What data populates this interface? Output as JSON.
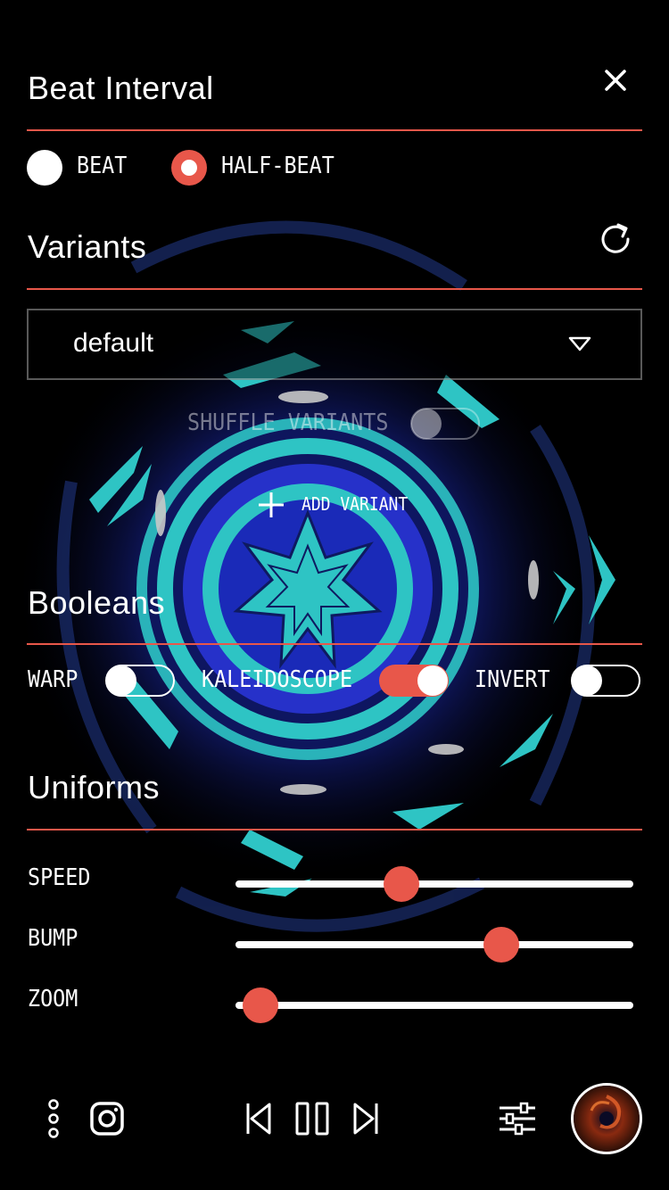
{
  "beat_interval": {
    "title": "Beat Interval",
    "options": [
      {
        "label": "BEAT",
        "selected": false
      },
      {
        "label": "HALF-BEAT",
        "selected": true
      }
    ]
  },
  "variants": {
    "title": "Variants",
    "selected": "default",
    "shuffle_label": "SHUFFLE VARIANTS",
    "shuffle_on": false,
    "add_label": "ADD VARIANT"
  },
  "booleans": {
    "title": "Booleans",
    "items": [
      {
        "label": "WARP",
        "on": false
      },
      {
        "label": "KALEIDOSCOPE",
        "on": true
      },
      {
        "label": "INVERT",
        "on": false
      }
    ]
  },
  "uniforms": {
    "title": "Uniforms",
    "sliders": [
      {
        "label": "SPEED",
        "value": 0.42
      },
      {
        "label": "BUMP",
        "value": 0.67
      },
      {
        "label": "ZOOM",
        "value": 0.06
      }
    ]
  },
  "colors": {
    "accent": "#e8574a",
    "teal": "#2ec4c4",
    "blue": "#2a3fd6"
  },
  "icons": {
    "close": "close-icon",
    "refresh": "refresh-icon",
    "more": "more-vertical-icon",
    "instagram": "instagram-icon",
    "previous": "skip-previous-icon",
    "pause": "pause-icon",
    "next": "skip-next-icon",
    "settings": "sliders-icon",
    "avatar": "visualizer-thumbnail"
  }
}
